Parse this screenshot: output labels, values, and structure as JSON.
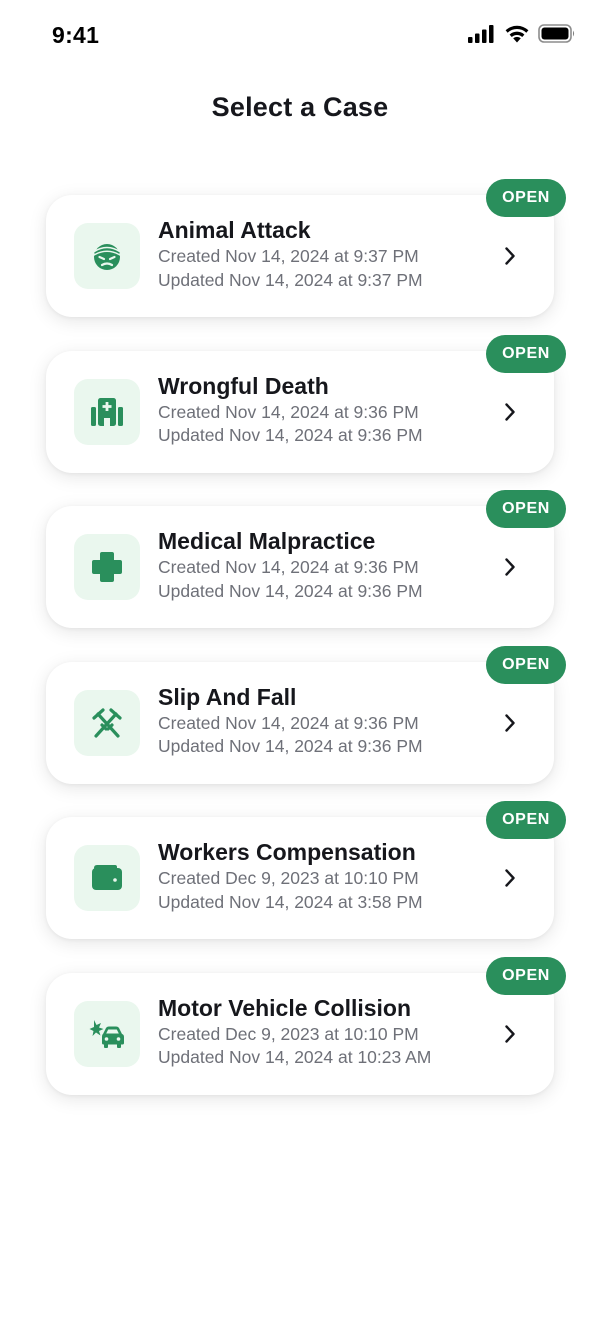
{
  "status_bar": {
    "time": "9:41",
    "icons": [
      "cellular-signal-icon",
      "wifi-icon",
      "battery-icon"
    ]
  },
  "header": {
    "title": "Select a Case"
  },
  "colors": {
    "accent": "#2a8f5c",
    "icon_bg": "#eaf7ee",
    "title_text": "#16171c",
    "meta_text": "#6e7078"
  },
  "cases": [
    {
      "title": "Animal Attack",
      "created": "Created Nov 14, 2024 at 9:37 PM",
      "updated": "Updated Nov 14, 2024 at 9:37 PM",
      "status": "OPEN",
      "icon": "injured-face-icon"
    },
    {
      "title": "Wrongful Death",
      "created": "Created Nov 14, 2024 at 9:36 PM",
      "updated": "Updated Nov 14, 2024 at 9:36 PM",
      "status": "OPEN",
      "icon": "hospital-icon"
    },
    {
      "title": "Medical Malpractice",
      "created": "Created Nov 14, 2024 at 9:36 PM",
      "updated": "Updated Nov 14, 2024 at 9:36 PM",
      "status": "OPEN",
      "icon": "medical-cross-icon"
    },
    {
      "title": "Slip And Fall",
      "created": "Created Nov 14, 2024 at 9:36 PM",
      "updated": "Updated Nov 14, 2024 at 9:36 PM",
      "status": "OPEN",
      "icon": "crutches-icon"
    },
    {
      "title": "Workers Compensation",
      "created": "Created Dec 9, 2023 at 10:10 PM",
      "updated": "Updated Nov 14, 2024 at 3:58 PM",
      "status": "OPEN",
      "icon": "wallet-icon"
    },
    {
      "title": "Motor Vehicle Collision",
      "created": "Created Dec 9, 2023 at 10:10 PM",
      "updated": "Updated Nov 14, 2024 at 10:23 AM",
      "status": "OPEN",
      "icon": "car-crash-icon"
    }
  ]
}
